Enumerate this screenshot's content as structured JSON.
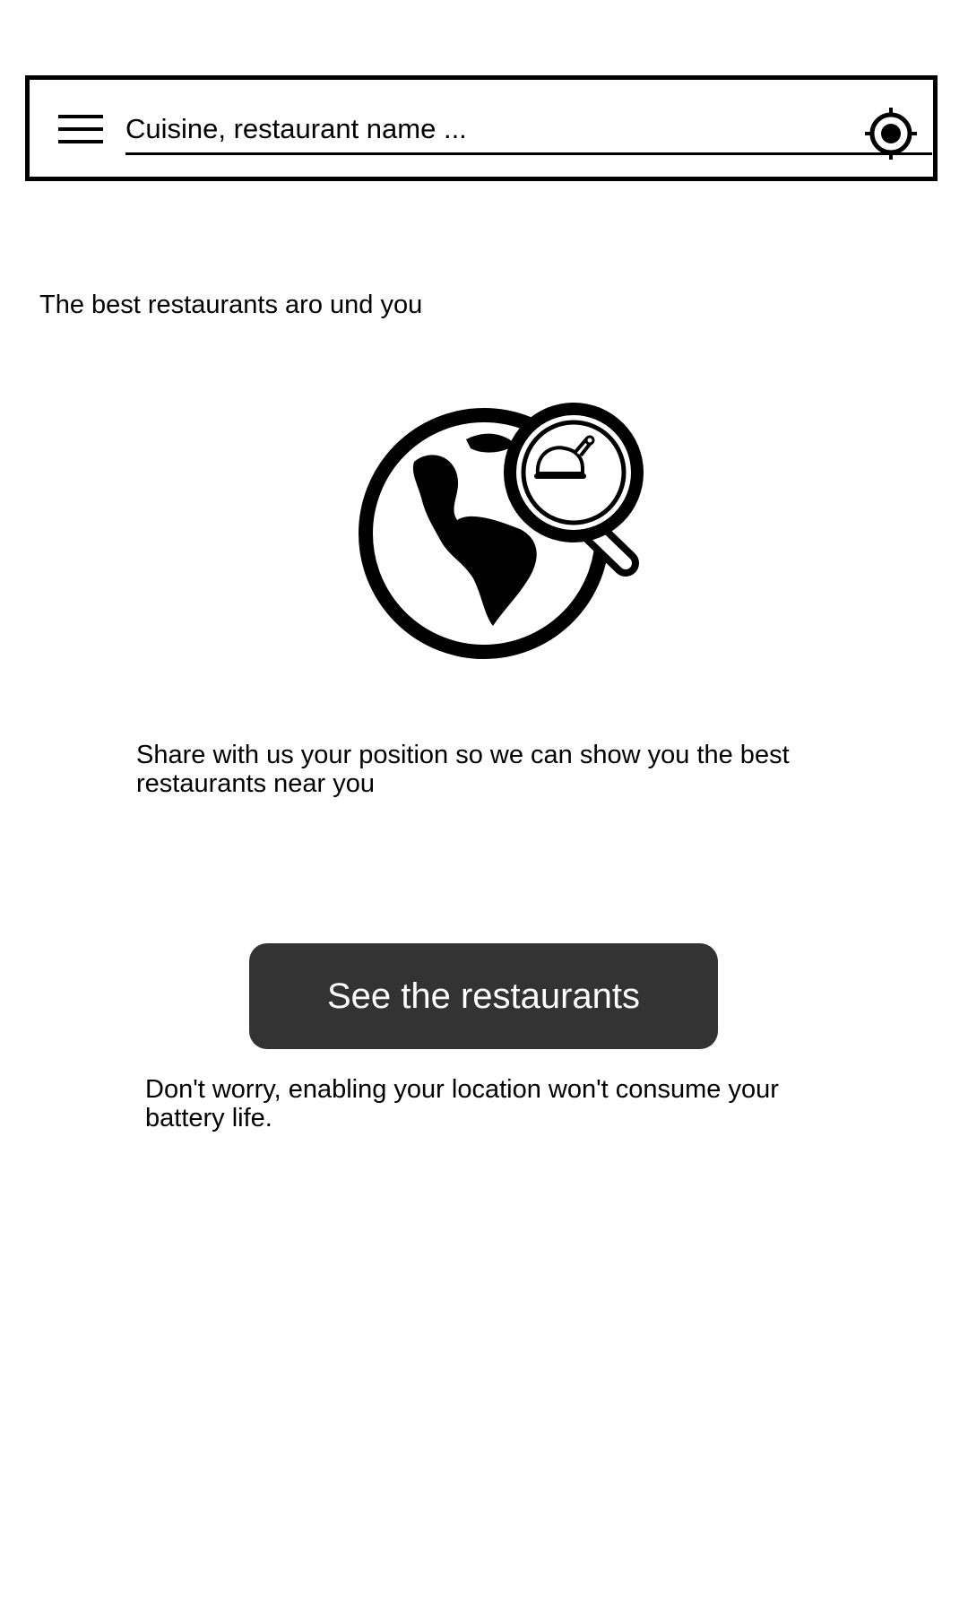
{
  "search": {
    "placeholder": "Cuisine, restaurant name ..."
  },
  "icons": {
    "menu": "hamburger-menu-icon",
    "locate": "crosshair-location-icon",
    "illustration": "globe-with-magnifier-chicken-icon"
  },
  "main": {
    "headline": "The best restaurants aro und you",
    "share_text": "Share with us your position so we can show you the best restaurants near you",
    "cta_label": "See the restaurants",
    "battery_note": "Don't worry, enabling your location won't consume your battery life."
  },
  "colors": {
    "button_bg": "#333333",
    "button_text": "#ffffff",
    "border": "#000000",
    "background": "#ffffff"
  }
}
